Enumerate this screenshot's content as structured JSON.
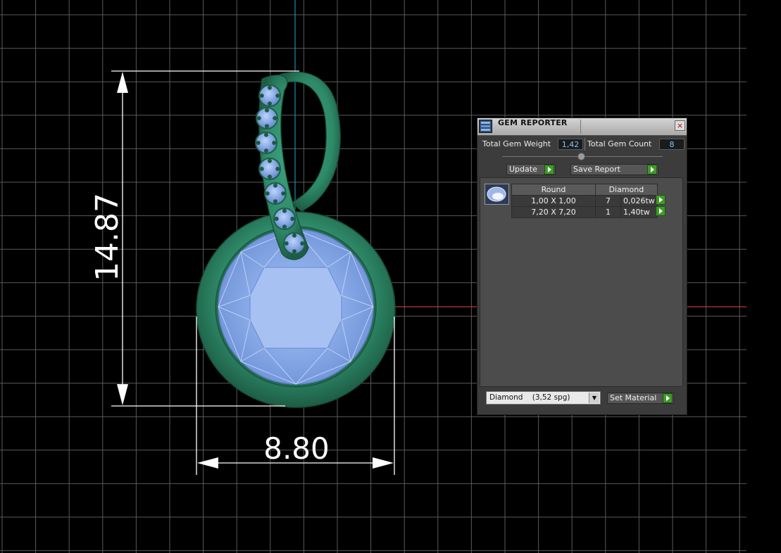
{
  "viewport": {
    "dim_height": "14.87",
    "dim_width": "8.80",
    "colors": {
      "background": "#000000",
      "grid": "#5a5a5a",
      "metal": "#2e8a68",
      "gem": "#8fb3f2",
      "x_axis": "#c0392b",
      "y_axis": "#1b8fa8",
      "dimension": "#ffffff"
    }
  },
  "gem_reporter": {
    "title": "GEM REPORTER",
    "close_icon": "×",
    "total_weight_label": "Total Gem Weight",
    "total_weight_value": "1,42",
    "total_count_label": "Total Gem Count",
    "total_count_value": "8",
    "update_label": "Update",
    "save_report_label": "Save Report",
    "table": {
      "headers": [
        "Round",
        "Diamond"
      ],
      "rows": [
        {
          "size": "1,00 X 1,00",
          "qty": "7",
          "weight": "0,026tw"
        },
        {
          "size": "7,20 X 7,20",
          "qty": "1",
          "weight": "1,40tw"
        }
      ]
    },
    "material_select": {
      "value": "Diamond    (3,52 spg)"
    },
    "set_material_label": "Set Material",
    "accent_color": "#3f9a2a"
  }
}
